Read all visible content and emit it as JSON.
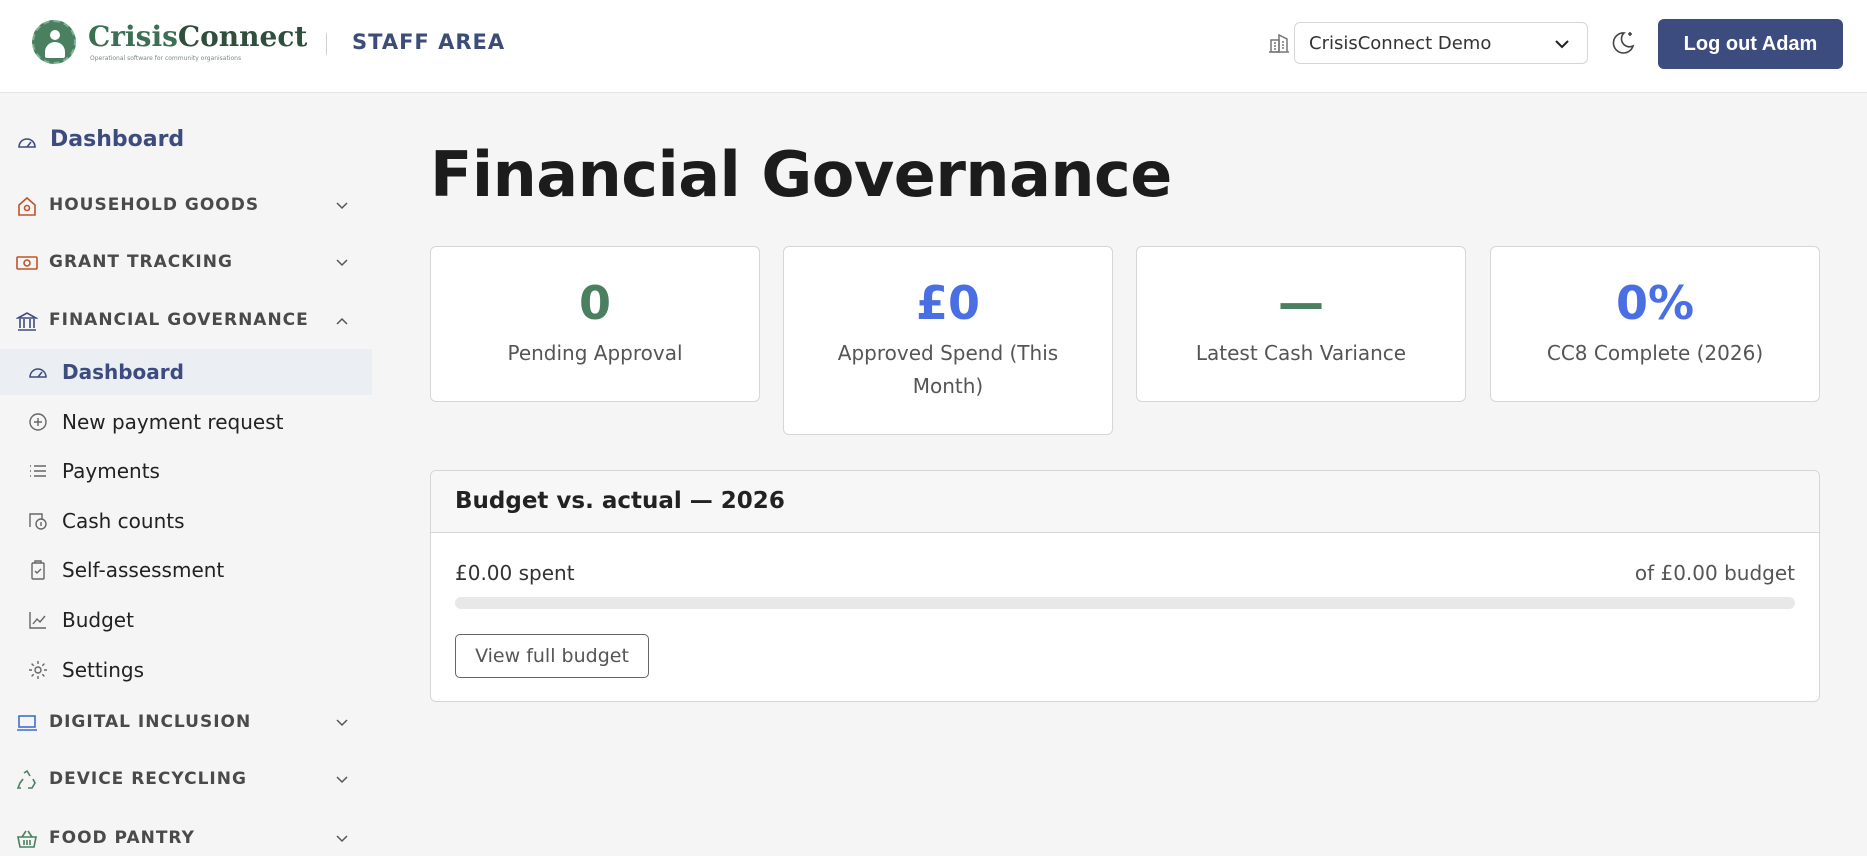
{
  "header": {
    "logo": {
      "name_main": "Crisis",
      "name_sub": "Connect",
      "tagline": "Operational software for community organisations"
    },
    "area_label": "STAFF AREA",
    "org_selector": {
      "selected": "CrisisConnect Demo",
      "icon": "building-icon"
    },
    "theme_toggle_icon": "moon-stars-icon",
    "logout_label": "Log out Adam"
  },
  "sidebar": {
    "top_item": {
      "label": "Dashboard",
      "icon": "gauge-icon"
    },
    "sections": [
      {
        "label": "HOUSEHOLD GOODS",
        "icon": "house-icon",
        "expanded": false
      },
      {
        "label": "GRANT TRACKING",
        "icon": "cash-icon",
        "expanded": false
      },
      {
        "label": "FINANCIAL GOVERNANCE",
        "icon": "bank-icon",
        "expanded": true
      },
      {
        "label": "DIGITAL INCLUSION",
        "icon": "laptop-icon",
        "expanded": false
      },
      {
        "label": "DEVICE RECYCLING",
        "icon": "recycle-icon",
        "expanded": false
      },
      {
        "label": "FOOD PANTRY",
        "icon": "basket-icon",
        "expanded": false
      }
    ],
    "governance_items": [
      {
        "label": "Dashboard",
        "icon": "gauge-icon",
        "active": true
      },
      {
        "label": "New payment request",
        "icon": "plus-circle-icon",
        "active": false
      },
      {
        "label": "Payments",
        "icon": "list-icon",
        "active": false
      },
      {
        "label": "Cash counts",
        "icon": "cash-count-icon",
        "active": false
      },
      {
        "label": "Self-assessment",
        "icon": "clipboard-check-icon",
        "active": false
      },
      {
        "label": "Budget",
        "icon": "line-chart-icon",
        "active": false
      },
      {
        "label": "Settings",
        "icon": "gear-icon",
        "active": false
      }
    ]
  },
  "main": {
    "title": "Financial Governance",
    "stats": [
      {
        "value": "0",
        "label": "Pending Approval",
        "color": "#4a8060"
      },
      {
        "value": "£0",
        "label": "Approved Spend (This Month)",
        "color": "#4a6fe3"
      },
      {
        "value": "—",
        "label": "Latest Cash Variance",
        "color": "#4a8060"
      },
      {
        "value": "0%",
        "label": "CC8 Complete (2026)",
        "color": "#4a6fe3"
      }
    ],
    "budget": {
      "title": "Budget vs. actual — 2026",
      "spent": "£0.00 spent",
      "of_budget": "of £0.00 budget",
      "progress": 0,
      "view_label": "View full budget"
    }
  },
  "colors": {
    "primary": "#3d4c7e",
    "accent_green": "#4a8060",
    "accent_blue": "#4a6fe3",
    "section_icon": "#c0542c"
  }
}
